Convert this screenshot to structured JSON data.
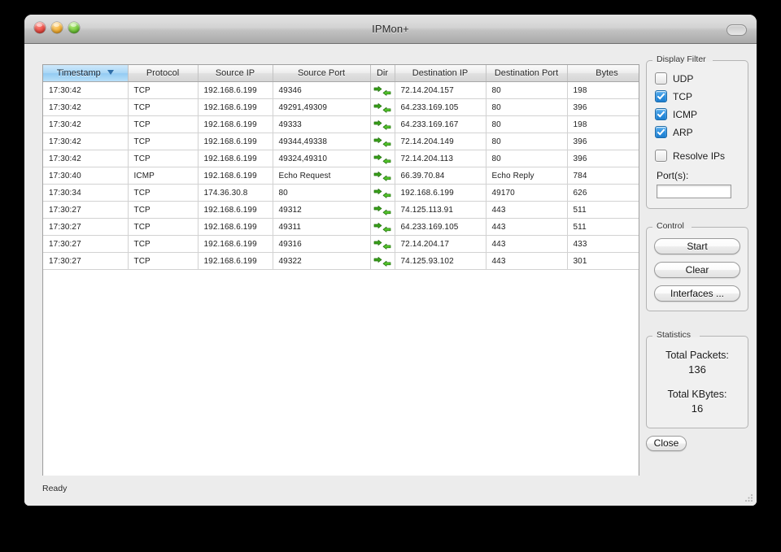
{
  "window": {
    "title": "IPMon+",
    "traffic_lights": [
      "close-button",
      "minimize-button",
      "zoom-button"
    ],
    "toolbar_toggle": "toolbar-toggle-pill"
  },
  "table": {
    "columns": [
      {
        "key": "timestamp",
        "label": "Timestamp",
        "sorted": true,
        "sort_dir": "descending"
      },
      {
        "key": "protocol",
        "label": "Protocol",
        "sorted": false
      },
      {
        "key": "source_ip",
        "label": "Source IP",
        "sorted": false
      },
      {
        "key": "source_port",
        "label": "Source Port",
        "sorted": false
      },
      {
        "key": "dir",
        "label": "Dir",
        "sorted": false
      },
      {
        "key": "destination_ip",
        "label": "Destination IP",
        "sorted": false
      },
      {
        "key": "destination_port",
        "label": "Destination Port",
        "sorted": false
      },
      {
        "key": "bytes",
        "label": "Bytes",
        "sorted": false
      }
    ],
    "rows": [
      {
        "timestamp": "17:30:42",
        "protocol": "TCP",
        "source_ip": "192.168.6.199",
        "source_port": "49346",
        "dir": "bidirectional",
        "destination_ip": "72.14.204.157",
        "destination_port": "80",
        "bytes": "198"
      },
      {
        "timestamp": "17:30:42",
        "protocol": "TCP",
        "source_ip": "192.168.6.199",
        "source_port": "49291,49309",
        "dir": "bidirectional",
        "destination_ip": "64.233.169.105",
        "destination_port": "80",
        "bytes": "396"
      },
      {
        "timestamp": "17:30:42",
        "protocol": "TCP",
        "source_ip": "192.168.6.199",
        "source_port": "49333",
        "dir": "bidirectional",
        "destination_ip": "64.233.169.167",
        "destination_port": "80",
        "bytes": "198"
      },
      {
        "timestamp": "17:30:42",
        "protocol": "TCP",
        "source_ip": "192.168.6.199",
        "source_port": "49344,49338",
        "dir": "bidirectional",
        "destination_ip": "72.14.204.149",
        "destination_port": "80",
        "bytes": "396"
      },
      {
        "timestamp": "17:30:42",
        "protocol": "TCP",
        "source_ip": "192.168.6.199",
        "source_port": "49324,49310",
        "dir": "bidirectional",
        "destination_ip": "72.14.204.113",
        "destination_port": "80",
        "bytes": "396"
      },
      {
        "timestamp": "17:30:40",
        "protocol": "ICMP",
        "source_ip": "192.168.6.199",
        "source_port": "Echo Request",
        "dir": "bidirectional",
        "destination_ip": "66.39.70.84",
        "destination_port": "Echo Reply",
        "bytes": "784"
      },
      {
        "timestamp": "17:30:34",
        "protocol": "TCP",
        "source_ip": "174.36.30.8",
        "source_port": "80",
        "dir": "bidirectional",
        "destination_ip": "192.168.6.199",
        "destination_port": "49170",
        "bytes": "626"
      },
      {
        "timestamp": "17:30:27",
        "protocol": "TCP",
        "source_ip": "192.168.6.199",
        "source_port": "49312",
        "dir": "bidirectional",
        "destination_ip": "74.125.113.91",
        "destination_port": "443",
        "bytes": "511"
      },
      {
        "timestamp": "17:30:27",
        "protocol": "TCP",
        "source_ip": "192.168.6.199",
        "source_port": "49311",
        "dir": "bidirectional",
        "destination_ip": "64.233.169.105",
        "destination_port": "443",
        "bytes": "511"
      },
      {
        "timestamp": "17:30:27",
        "protocol": "TCP",
        "source_ip": "192.168.6.199",
        "source_port": "49316",
        "dir": "bidirectional",
        "destination_ip": "72.14.204.17",
        "destination_port": "443",
        "bytes": "433"
      },
      {
        "timestamp": "17:30:27",
        "protocol": "TCP",
        "source_ip": "192.168.6.199",
        "source_port": "49322",
        "dir": "bidirectional",
        "destination_ip": "74.125.93.102",
        "destination_port": "443",
        "bytes": "301"
      }
    ]
  },
  "display_filter": {
    "legend": "Display Filter",
    "checkboxes": [
      {
        "label": "UDP",
        "checked": false
      },
      {
        "label": "TCP",
        "checked": true
      },
      {
        "label": "ICMP",
        "checked": true
      },
      {
        "label": "ARP",
        "checked": true
      }
    ],
    "resolve_ips": {
      "label": "Resolve IPs",
      "checked": false
    },
    "ports_label": "Port(s):",
    "ports_value": "",
    "ports_placeholder": ""
  },
  "control": {
    "legend": "Control",
    "buttons": [
      {
        "label": "Start"
      },
      {
        "label": "Clear"
      },
      {
        "label": "Interfaces ..."
      }
    ]
  },
  "statistics": {
    "legend": "Statistics",
    "total_packets_label": "Total Packets:",
    "total_packets_value": "136",
    "total_kbytes_label": "Total KBytes:",
    "total_kbytes_value": "16"
  },
  "close_button": {
    "label": "Close"
  },
  "statusbar": {
    "text": "Ready",
    "grip": "resize-grip-icon"
  },
  "colors": {
    "accent_blue": "#2b8ede",
    "sorted_header": "#aad7f6",
    "arrow_green": "#3aa31a",
    "window_bg": "#ececec",
    "desktop": "#000000"
  }
}
